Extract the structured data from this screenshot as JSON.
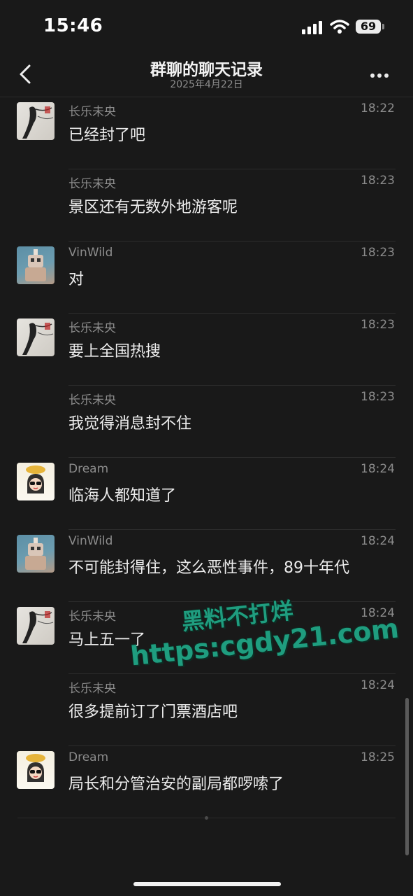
{
  "status_bar": {
    "time": "15:46",
    "battery": "69"
  },
  "header": {
    "title": "群聊的聊天记录",
    "subtitle": "2025年4月22日"
  },
  "messages": [
    {
      "sender": "长乐未央",
      "time": "18:22",
      "text": "已经封了吧",
      "avatar": "ink-painting"
    },
    {
      "sender": "长乐未央",
      "time": "18:23",
      "text": "景区还有无数外地游客呢",
      "avatar": ""
    },
    {
      "sender": "VinWild",
      "time": "18:23",
      "text": "对",
      "avatar": "robot-art"
    },
    {
      "sender": "长乐未央",
      "time": "18:23",
      "text": "要上全国热搜",
      "avatar": "ink-painting"
    },
    {
      "sender": "长乐未央",
      "time": "18:23",
      "text": "我觉得消息封不住",
      "avatar": ""
    },
    {
      "sender": "Dream",
      "time": "18:24",
      "text": "临海人都知道了",
      "avatar": "cartoon-girl"
    },
    {
      "sender": "VinWild",
      "time": "18:24",
      "text": "不可能封得住，这么恶性事件，89十年代",
      "avatar": "robot-art"
    },
    {
      "sender": "长乐未央",
      "time": "18:24",
      "text": "马上五一了",
      "avatar": "ink-painting"
    },
    {
      "sender": "长乐未央",
      "time": "18:24",
      "text": "很多提前订了门票酒店吧",
      "avatar": ""
    },
    {
      "sender": "Dream",
      "time": "18:25",
      "text": "局长和分管治安的副局都啰嗦了",
      "avatar": "cartoon-girl"
    }
  ],
  "watermark": {
    "line1": "黑料不打烊",
    "line2": "https:cgdy21.com"
  },
  "colors": {
    "background": "#191919",
    "watermark": "#1f9d7f"
  }
}
